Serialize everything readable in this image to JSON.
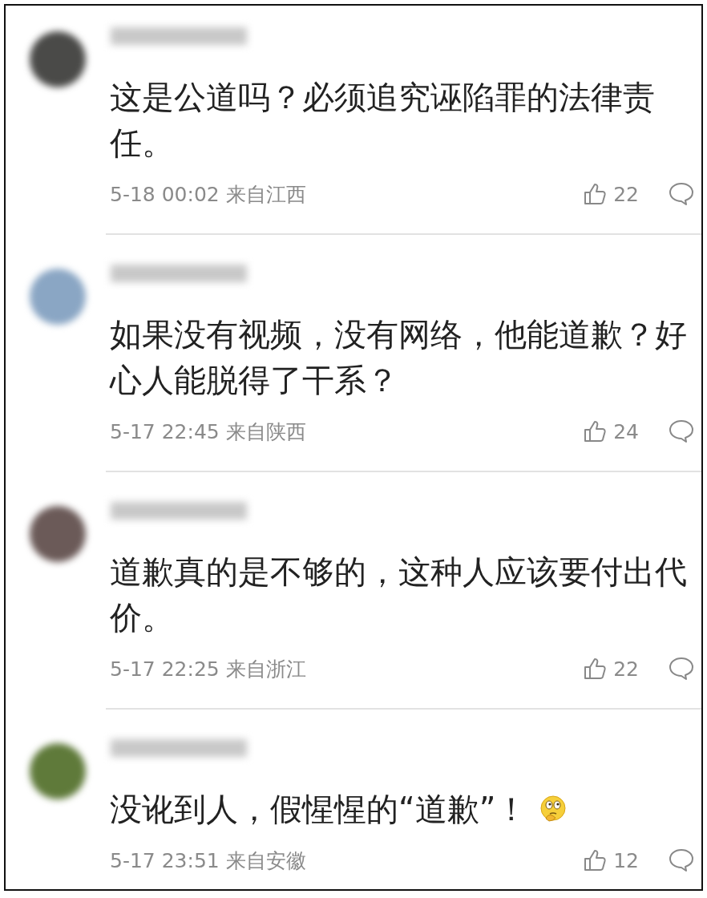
{
  "comments": [
    {
      "text": "这是公道吗？必须追究诬陷罪的法律责任。",
      "time": "5-18 00:02",
      "location": "来自江西",
      "likes": "22",
      "emoji": false
    },
    {
      "text": "如果没有视频，没有网络，他能道歉？好心人能脱得了干系？",
      "time": "5-17 22:45",
      "location": "来自陕西",
      "likes": "24",
      "emoji": false
    },
    {
      "text": "道歉真的是不够的，这种人应该要付出代价。",
      "time": "5-17 22:25",
      "location": "来自浙江",
      "likes": "22",
      "emoji": false
    },
    {
      "text": "没讹到人，假惺惺的“道歉”！",
      "time": "5-17 23:51",
      "location": "来自安徽",
      "likes": "12",
      "emoji": true
    }
  ]
}
